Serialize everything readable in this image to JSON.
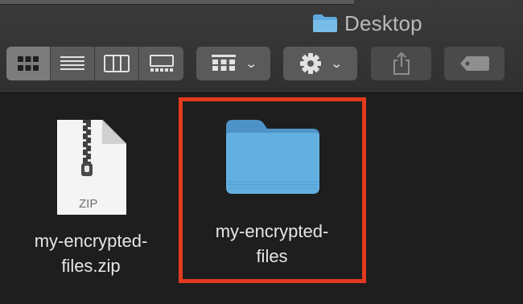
{
  "window": {
    "title": "Desktop",
    "title_icon": "folder-icon"
  },
  "toolbar": {
    "view_modes": [
      {
        "name": "icon-view",
        "icon": "grid-icon",
        "active": true
      },
      {
        "name": "list-view",
        "icon": "list-icon",
        "active": false
      },
      {
        "name": "column-view",
        "icon": "columns-icon",
        "active": false
      },
      {
        "name": "gallery-view",
        "icon": "gallery-icon",
        "active": false
      }
    ],
    "group_button_icon": "group-by-icon",
    "action_button_icon": "gear-icon",
    "share_button_icon": "share-icon",
    "tag_button_icon": "tag-icon",
    "chevron_glyph": "⌄"
  },
  "files": [
    {
      "name": "my-encrypted-\nfiles.zip",
      "type": "zip",
      "badge": "ZIP"
    },
    {
      "name": "my-encrypted-\nfiles",
      "type": "folder",
      "highlighted": true
    }
  ],
  "colors": {
    "highlight": "#e23a1f",
    "folder_blue": "#5aa7d8"
  }
}
